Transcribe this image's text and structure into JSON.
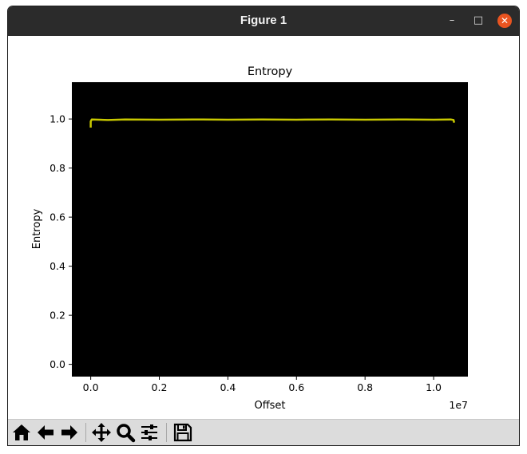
{
  "window": {
    "title": "Figure 1"
  },
  "window_controls": {
    "minimize": "–",
    "maximize": "□",
    "close": "✕"
  },
  "toolbar": {
    "buttons": [
      {
        "name": "home-button",
        "icon": "home-icon"
      },
      {
        "name": "back-button",
        "icon": "arrow-left-icon"
      },
      {
        "name": "forward-button",
        "icon": "arrow-right-icon"
      },
      {
        "name": "pan-button",
        "icon": "move-icon"
      },
      {
        "name": "zoom-button",
        "icon": "magnifier-icon"
      },
      {
        "name": "configure-subplots-button",
        "icon": "sliders-icon"
      },
      {
        "name": "save-button",
        "icon": "floppy-disk-icon"
      }
    ]
  },
  "chart_data": {
    "type": "line",
    "title": "Entropy",
    "xlabel": "Offset",
    "ylabel": "Entropy",
    "x_offset_label": "1e7",
    "xlim": [
      -0.055,
      1.1
    ],
    "ylim": [
      -0.05,
      1.15
    ],
    "x_ticks": [
      0.0,
      0.2,
      0.4,
      0.6,
      0.8,
      1.0
    ],
    "x_tick_labels": [
      "0.0",
      "0.2",
      "0.4",
      "0.6",
      "0.8",
      "1.0"
    ],
    "y_ticks": [
      0.0,
      0.2,
      0.4,
      0.6,
      0.8,
      1.0
    ],
    "y_tick_labels": [
      "0.0",
      "0.2",
      "0.4",
      "0.6",
      "0.8",
      "1.0"
    ],
    "background_color": "#000000",
    "grid": false,
    "series": [
      {
        "color": "#c8c800",
        "x": [
          0.0,
          0.0,
          0.003,
          0.05,
          0.1,
          0.2,
          0.3,
          0.4,
          0.5,
          0.6,
          0.7,
          0.8,
          0.9,
          1.0,
          1.05,
          1.058,
          1.06
        ],
        "y": [
          0.965,
          0.99,
          0.998,
          0.996,
          0.998,
          0.997,
          0.998,
          0.997,
          0.998,
          0.997,
          0.998,
          0.997,
          0.998,
          0.997,
          0.998,
          0.996,
          0.985
        ]
      }
    ]
  }
}
